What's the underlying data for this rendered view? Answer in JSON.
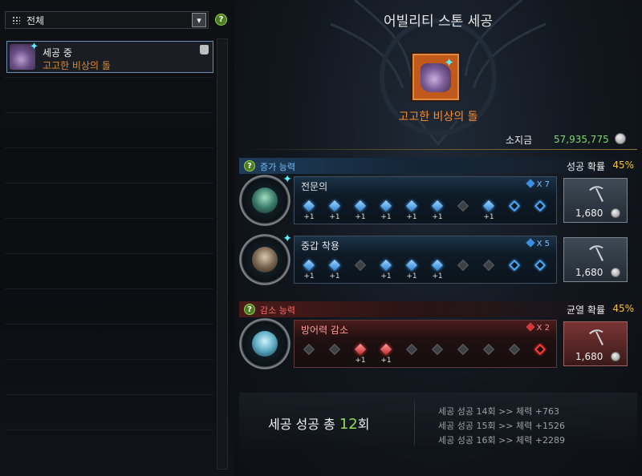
{
  "left": {
    "filter": {
      "label": "전체",
      "dropdown_icon": "chevron-down-icon"
    },
    "help_icon": "?",
    "items": [
      {
        "status": "세공 중",
        "name": "고고한 비상의 돌"
      }
    ]
  },
  "right": {
    "title": "어빌리티 스톤 세공",
    "stone_name": "고고한 비상의 돌",
    "money_label": "소지금",
    "money_value": "57,935,775",
    "sections": {
      "increase": {
        "label": "증가 능력",
        "rate_label": "성공 확률",
        "rate_value": "45%",
        "help": "?"
      },
      "decrease": {
        "label": "감소 능력",
        "rate_label": "균열 확률",
        "rate_value": "45%",
        "help": "?"
      }
    },
    "abilities": [
      {
        "name": "전문의",
        "count": "X 7",
        "slots": [
          "ok",
          "ok",
          "ok",
          "ok",
          "ok",
          "ok",
          "fail",
          "ok",
          "empty",
          "empty"
        ],
        "pluses": [
          "+1",
          "+1",
          "+1",
          "+1",
          "+1",
          "+1",
          "",
          "+1",
          "",
          ""
        ],
        "cost": "1,680"
      },
      {
        "name": "중갑 착용",
        "count": "X 5",
        "slots": [
          "ok",
          "ok",
          "fail",
          "ok",
          "ok",
          "ok",
          "fail",
          "fail",
          "empty",
          "empty"
        ],
        "pluses": [
          "+1",
          "+1",
          "",
          "+1",
          "+1",
          "+1",
          "",
          "",
          "",
          ""
        ],
        "cost": "1,680"
      },
      {
        "name": "방어력 감소",
        "count": "X 2",
        "slots": [
          "fail",
          "fail",
          "rok",
          "rok",
          "fail",
          "fail",
          "fail",
          "fail",
          "fail",
          "rempty"
        ],
        "pluses": [
          "",
          "",
          "+1",
          "+1",
          "",
          "",
          "",
          "",
          "",
          ""
        ],
        "cost": "1,680"
      }
    ],
    "summary": {
      "total_prefix": "세공 성공 총 ",
      "total_num": "12",
      "total_suffix": "회",
      "history": [
        "세공 성공 14회 >> 체력 +763",
        "세공 성공 15회 >> 체력 +1526",
        "세공 성공 16회 >> 체력 +2289"
      ]
    }
  }
}
